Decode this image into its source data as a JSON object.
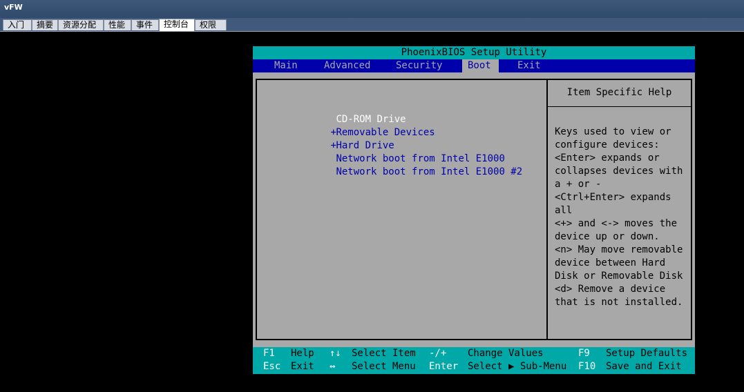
{
  "app": {
    "title": "vFW"
  },
  "tabs": [
    {
      "label": "入门"
    },
    {
      "label": "摘要"
    },
    {
      "label": "资源分配"
    },
    {
      "label": "性能"
    },
    {
      "label": "事件"
    },
    {
      "label": "控制台",
      "active": true
    },
    {
      "label": "权限"
    }
  ],
  "bios": {
    "title": "PhoenixBIOS Setup Utility",
    "menu": [
      "Main",
      "Advanced",
      "Security",
      "Boot",
      "Exit"
    ],
    "active_menu": "Boot",
    "boot_items": [
      {
        "prefix": "",
        "label": "CD-ROM Drive",
        "selected": true
      },
      {
        "prefix": "+",
        "label": "Removable Devices"
      },
      {
        "prefix": "+",
        "label": "Hard Drive"
      },
      {
        "prefix": "",
        "label": "Network boot from Intel E1000"
      },
      {
        "prefix": "",
        "label": "Network boot from Intel E1000 #2"
      }
    ],
    "help": {
      "header": "Item Specific Help",
      "lines": [
        "Keys used to view or",
        "configure devices:",
        "<Enter> expands or",
        "collapses devices with",
        "a + or -",
        "<Ctrl+Enter> expands",
        "all",
        "<+> and <-> moves the",
        "device up or down.",
        "<n> May move removable",
        "device between Hard",
        "Disk or Removable Disk",
        "<d> Remove a device",
        "that is not installed."
      ]
    },
    "footer": {
      "row1": {
        "k1": "F1",
        "d1": "Help",
        "k2": "↑↓",
        "d2": "Select Item",
        "k3": "-/+",
        "d3": "Change Values",
        "k4": "F9",
        "d4": "Setup Defaults"
      },
      "row2": {
        "k1": "Esc",
        "d1": "Exit",
        "k2": "↔",
        "d2": "Select Menu",
        "k3": "Enter",
        "d3": "Select ▶ Sub-Menu",
        "k4": "F10",
        "d4": "Save and Exit"
      }
    }
  }
}
